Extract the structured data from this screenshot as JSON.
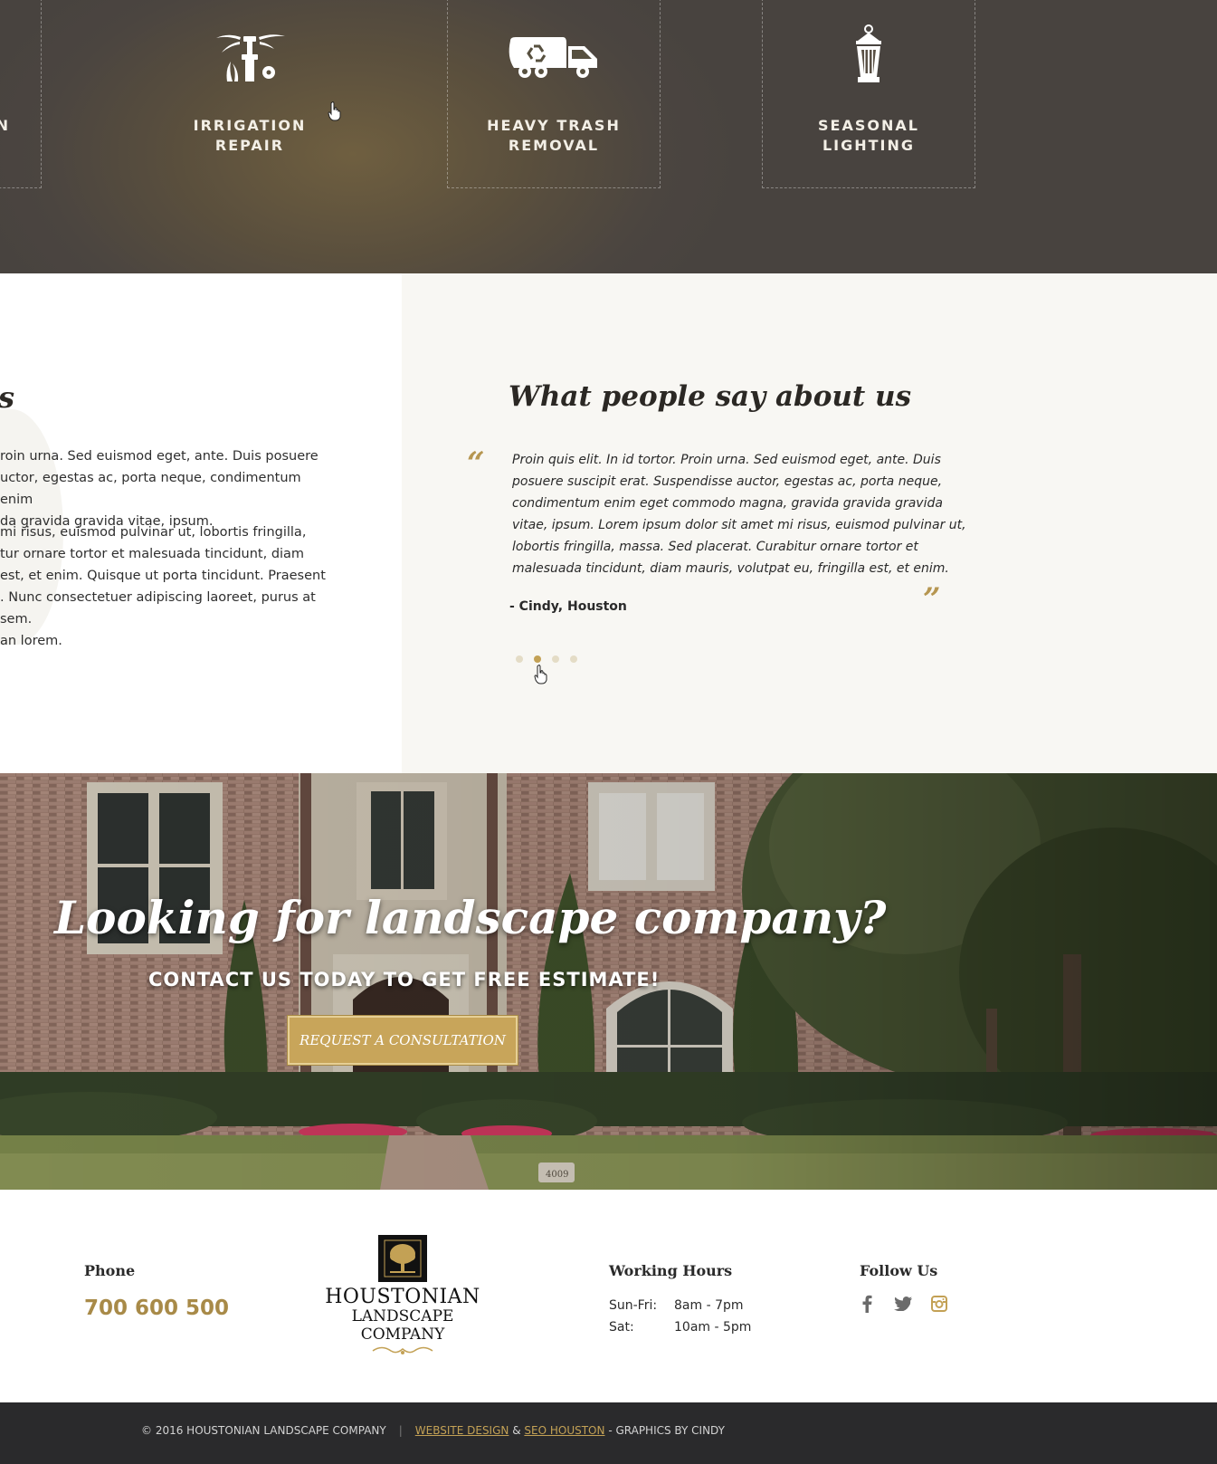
{
  "services": {
    "items": [
      {
        "label": "N",
        "icon": "service-icon"
      },
      {
        "label": "IRRIGATION\nREPAIR",
        "icon": "sprinkler-icon"
      },
      {
        "label": "HEAVY TRASH\nREMOVAL",
        "icon": "recycling-truck-icon"
      },
      {
        "label": "SEASONAL\nLIGHTING",
        "icon": "lantern-icon"
      }
    ]
  },
  "about": {
    "heading": "s",
    "paragraph1": "roin urna. Sed euismod eget, ante. Duis posuere\nuctor, egestas ac, porta neque, condimentum enim\nda gravida gravida vitae, ipsum.",
    "paragraph2": "mi risus, euismod pulvinar ut, lobortis fringilla,\ntur ornare tortor et malesuada tincidunt, diam\n est, et enim. Quisque ut porta tincidunt. Praesent\n. Nunc consectetuer adipiscing laoreet, purus at sem.\nan lorem."
  },
  "testimonials": {
    "heading": "What people say about us",
    "quote_open": "“",
    "quote_close": "”",
    "text": "Proin quis elit. In id tortor. Proin urna. Sed euismod eget, ante. Duis posuere suscipit erat. Suspendisse auctor, egestas ac, porta neque, condimentum enim eget commodo magna, gravida gravida gravida vitae, ipsum. Lorem ipsum dolor sit amet mi risus, euismod pulvinar ut, lobortis fringilla, massa. Sed placerat. Curabitur ornare tortor et malesuada tincidunt, diam mauris, volutpat eu, fringilla est, et enim.",
    "author": "- Cindy, Houston",
    "slide_count": 4,
    "active_slide": 2
  },
  "hero": {
    "title": "Looking for landscape company?",
    "subtitle": "CONTACT US TODAY TO GET FREE ESTIMATE!",
    "button_label": "REQUEST A CONSULTATION",
    "house_number": "4009"
  },
  "footer": {
    "phone_label": "Phone",
    "phone": "700 600 500",
    "logo_line1": "HOUSTONIAN",
    "logo_line2": "LANDSCAPE COMPANY",
    "hours_label": "Working Hours",
    "hours": [
      {
        "day": "Sun-Fri:",
        "time": "8am - 7pm"
      },
      {
        "day": "Sat:",
        "time": "10am - 5pm"
      }
    ],
    "follow_label": "Follow Us",
    "social": [
      "facebook-icon",
      "twitter-icon",
      "instagram-icon"
    ]
  },
  "bottom": {
    "copyright": "© 2016 HOUSTONIAN LANDSCAPE COMPANY",
    "separator": "|",
    "link1": "WEBSITE DESIGN",
    "amp": "&",
    "link2": "SEO HOUSTON",
    "credits": "- GRAPHICS BY CINDY"
  },
  "colors": {
    "accent": "#c3a155",
    "services_bg": "#4b4540",
    "testimonial_bg": "#f8f7f3",
    "bottom_bar": "#2a2a2c"
  }
}
